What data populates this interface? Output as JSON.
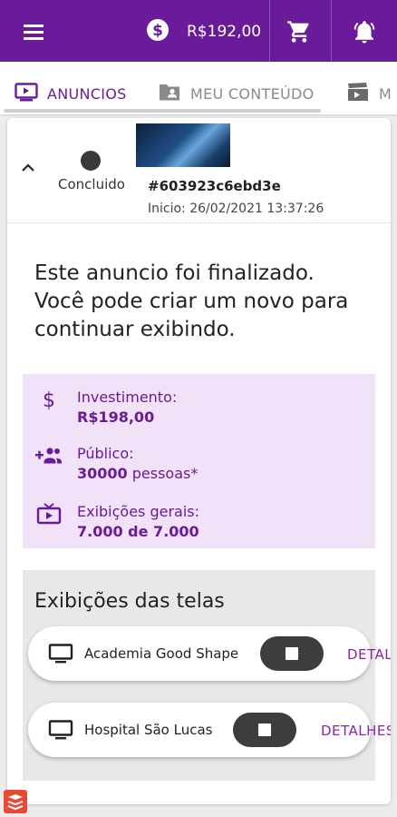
{
  "header": {
    "balance": "R$192,00",
    "icons": {
      "menu": "menu-icon",
      "money": "dollar-circle-icon",
      "cart": "cart-icon",
      "bell": "bell-ring-icon"
    },
    "colors": {
      "bar": "#6a1b9a"
    }
  },
  "tabs": [
    {
      "label": "ANUNCIOS",
      "icon": "play-screen-icon",
      "active": true
    },
    {
      "label": "MEU CONTEÚDO",
      "icon": "folder-person-icon",
      "active": false
    },
    {
      "label": "M",
      "icon": "clapperboard-icon",
      "active": false
    }
  ],
  "ad": {
    "status": "Concluido",
    "id": "#603923c6ebd3e",
    "start": "Inicio: 26/02/2021 13:37:26",
    "message": "Este anuncio foi finalizado. Você pode criar um novo para continuar exibindo."
  },
  "stats": {
    "investment_label": "Investimento:",
    "investment_value": "R$198,00",
    "audience_label": "Público:",
    "audience_value": "30000",
    "audience_unit": " pessoas*",
    "views_label": "Exibições gerais:",
    "views_value": "7.000 de 7.000"
  },
  "screens": {
    "title": "Exibições das telas",
    "items": [
      {
        "name": "Academia Good Shape",
        "details": "DETALHES"
      },
      {
        "name": "Hospital São Lucas",
        "details": "DETALHES"
      }
    ]
  }
}
